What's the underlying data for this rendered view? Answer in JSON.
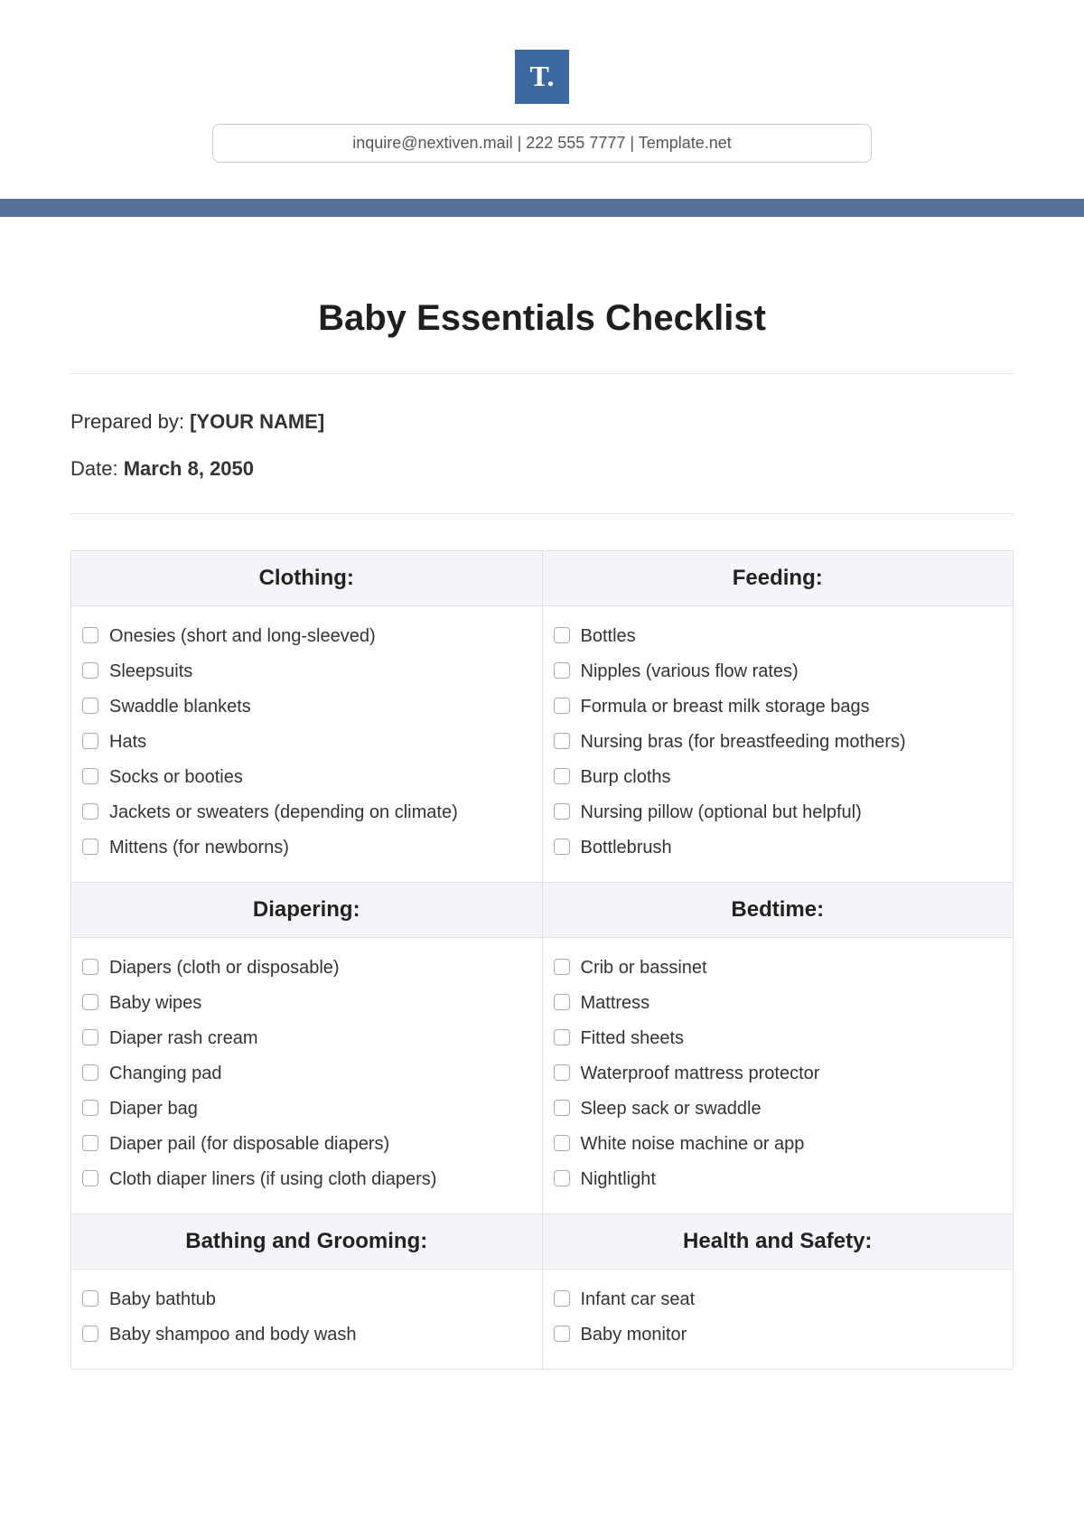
{
  "logo_text": "T.",
  "contact_line": "inquire@nextiven.mail  |  222 555 7777 |  Template.net",
  "title": "Baby Essentials Checklist",
  "meta": {
    "prepared_label": "Prepared by: ",
    "prepared_value": "[YOUR NAME]",
    "date_label": "Date: ",
    "date_value": "March 8, 2050"
  },
  "sections": [
    {
      "heading": "Clothing:",
      "items": [
        "Onesies (short and long-sleeved)",
        "Sleepsuits",
        "Swaddle blankets",
        "Hats",
        "Socks or booties",
        "Jackets or sweaters (depending on climate)",
        "Mittens (for newborns)"
      ]
    },
    {
      "heading": "Feeding:",
      "items": [
        "Bottles",
        "Nipples (various flow rates)",
        "Formula or breast milk storage bags",
        "Nursing bras (for breastfeeding mothers)",
        "Burp cloths",
        "Nursing pillow (optional but helpful)",
        "Bottlebrush"
      ]
    },
    {
      "heading": "Diapering:",
      "items": [
        "Diapers (cloth or disposable)",
        "Baby wipes",
        "Diaper rash cream",
        "Changing pad",
        "Diaper bag",
        "Diaper pail (for disposable diapers)",
        "Cloth diaper liners (if using cloth diapers)"
      ]
    },
    {
      "heading": "Bedtime:",
      "items": [
        "Crib or bassinet",
        "Mattress",
        "Fitted sheets",
        "Waterproof mattress protector",
        "Sleep sack or swaddle",
        "White noise machine or app",
        "Nightlight"
      ]
    },
    {
      "heading": "Bathing and Grooming:",
      "items": [
        "Baby bathtub",
        "Baby shampoo and body wash"
      ]
    },
    {
      "heading": "Health and Safety:",
      "items": [
        "Infant car seat",
        "Baby monitor"
      ]
    }
  ]
}
